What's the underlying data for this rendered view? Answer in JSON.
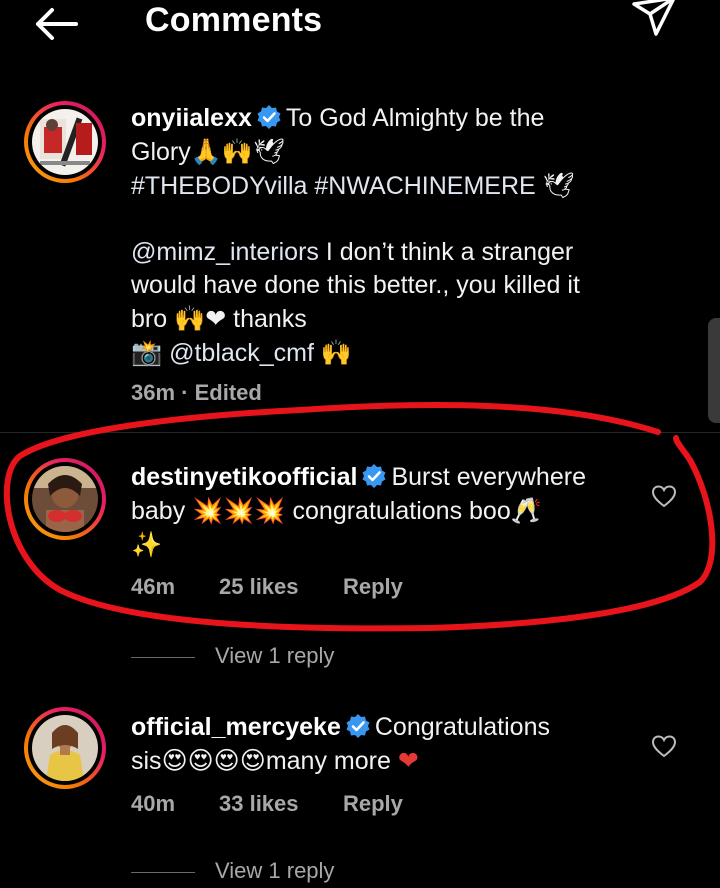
{
  "header": {
    "title": "Comments"
  },
  "comments": [
    {
      "username": "onyiialexx",
      "text_line1": "To God Almighty be the",
      "text_line2": "Glory",
      "text_line2_emoji": "🙏🙌🕊",
      "hashtags": "#THEBODYvilla #NWACHINEMERE",
      "hashtags_emoji": "🕊",
      "mention1": "@mimz_interiors",
      "text_line4": "I don’t think a stranger",
      "text_line5": "would have done this better., you killed it",
      "text_line6_start": "bro",
      "text_line6_emoji": "🙌❤",
      "text_line6_end": "thanks",
      "camera_emoji": "📸",
      "mention2": "@tblack_cmf",
      "end_emoji": "🙌",
      "time": "36m",
      "edited": "· Edited"
    },
    {
      "username": "destinyetikoofficial",
      "text_line1": "Burst everywhere",
      "text_line2_start": "baby",
      "text_line2_emoji": "💥💥💥",
      "text_line2_end": "congratulations boo",
      "text_line2_end_emoji": "🥂",
      "text_line3_emoji": "✨",
      "time": "46m",
      "likes": "25 likes",
      "reply": "Reply",
      "view_replies": "View 1 reply"
    },
    {
      "username": "official_mercyeke",
      "text_line1": "Congratulations",
      "text_line2_start": "sis",
      "text_line2_emoji": "😍😍😍😍",
      "text_line2_end": "many more",
      "text_line2_end_emoji": "❤",
      "time": "40m",
      "likes": "33 likes",
      "reply": "Reply",
      "view_replies": "View 1 reply"
    }
  ],
  "colors": {
    "background": "#000000",
    "verified": "#3897f0",
    "annotation": "#e8141b",
    "meta": "#a8a8a8"
  }
}
